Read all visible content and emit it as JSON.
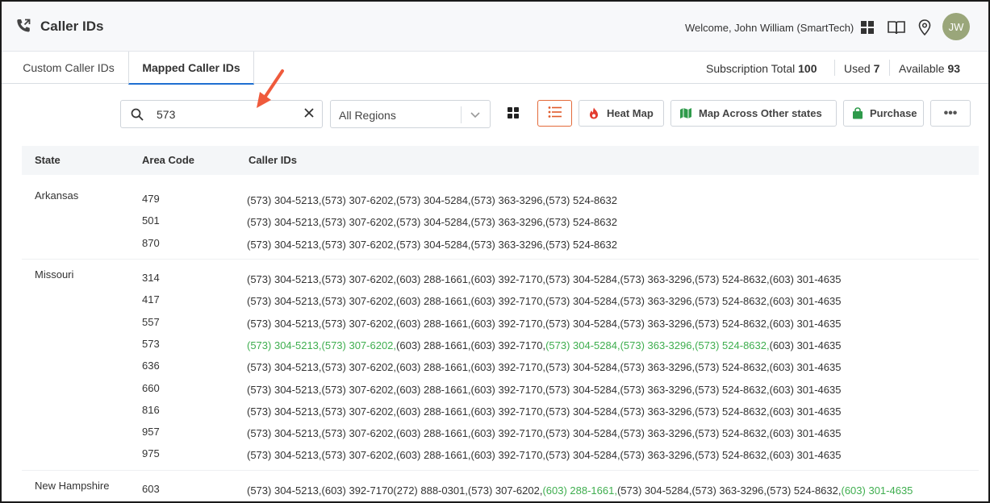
{
  "header": {
    "title": "Caller IDs",
    "app_icon": "phone-forward-icon",
    "welcome_prefix": "Welcome, John William ",
    "welcome_org": "(SmartTech)",
    "icons": [
      "apps-grid-icon",
      "book-icon",
      "location-pin-icon"
    ],
    "avatar_initials": "JW",
    "avatar_color": "#9aa67a"
  },
  "tabs": [
    {
      "label": "Custom Caller IDs",
      "active": false
    },
    {
      "label": "Mapped Caller IDs",
      "active": true
    }
  ],
  "subscription": {
    "total_label": "Subscription Total",
    "total_value": "100",
    "used_label": "Used",
    "used_value": "7",
    "available_label": "Available",
    "available_value": "93"
  },
  "toolbar": {
    "search_value": "573",
    "region_value": "All Regions",
    "heat_map_label": "Heat Map",
    "map_across_label": "Map Across Other states",
    "purchase_label": "Purchase",
    "more_label": "•••",
    "accent_color": "#e05a2a",
    "heat_map_icon": "flame-icon",
    "map_across_icon": "map-icon",
    "purchase_icon": "shopping-bag-icon"
  },
  "table": {
    "headers": [
      "State",
      "Area Code",
      "Caller IDs"
    ],
    "highlight_color": "#3fae4f",
    "groups": [
      {
        "state": "Arkansas",
        "rows": [
          {
            "code": "479",
            "parts": [
              {
                "t": "(573) 304-5213,(573) 307-6202,(573) 304-5284,(573) 363-3296,(573) 524-8632",
                "h": false
              }
            ]
          },
          {
            "code": "501",
            "parts": [
              {
                "t": "(573) 304-5213,(573) 307-6202,(573) 304-5284,(573) 363-3296,(573) 524-8632",
                "h": false
              }
            ]
          },
          {
            "code": "870",
            "parts": [
              {
                "t": "(573) 304-5213,(573) 307-6202,(573) 304-5284,(573) 363-3296,(573) 524-8632",
                "h": false
              }
            ]
          }
        ]
      },
      {
        "state": "Missouri",
        "rows": [
          {
            "code": "314",
            "parts": [
              {
                "t": "(573) 304-5213,(573) 307-6202,(603) 288-1661,(603) 392-7170,(573) 304-5284,(573) 363-3296,(573) 524-8632,(603) 301-4635",
                "h": false
              }
            ]
          },
          {
            "code": "417",
            "parts": [
              {
                "t": "(573) 304-5213,(573) 307-6202,(603) 288-1661,(603) 392-7170,(573) 304-5284,(573) 363-3296,(573) 524-8632,(603) 301-4635",
                "h": false
              }
            ]
          },
          {
            "code": "557",
            "parts": [
              {
                "t": "(573) 304-5213,(573) 307-6202,(603) 288-1661,(603) 392-7170,(573) 304-5284,(573) 363-3296,(573) 524-8632,(603) 301-4635",
                "h": false
              }
            ]
          },
          {
            "code": "573",
            "parts": [
              {
                "t": "(573) 304-5213,(573) 307-6202,",
                "h": true
              },
              {
                "t": "(603) 288-1661,(603) 392-7170,",
                "h": false
              },
              {
                "t": "(573) 304-5284,(573) 363-3296,(573) 524-8632,",
                "h": true
              },
              {
                "t": "(603) 301-4635",
                "h": false
              }
            ]
          },
          {
            "code": "636",
            "parts": [
              {
                "t": "(573) 304-5213,(573) 307-6202,(603) 288-1661,(603) 392-7170,(573) 304-5284,(573) 363-3296,(573) 524-8632,(603) 301-4635",
                "h": false
              }
            ]
          },
          {
            "code": "660",
            "parts": [
              {
                "t": "(573) 304-5213,(573) 307-6202,(603) 288-1661,(603) 392-7170,(573) 304-5284,(573) 363-3296,(573) 524-8632,(603) 301-4635",
                "h": false
              }
            ]
          },
          {
            "code": "816",
            "parts": [
              {
                "t": "(573) 304-5213,(573) 307-6202,(603) 288-1661,(603) 392-7170,(573) 304-5284,(573) 363-3296,(573) 524-8632,(603) 301-4635",
                "h": false
              }
            ]
          },
          {
            "code": "957",
            "parts": [
              {
                "t": "(573) 304-5213,(573) 307-6202,(603) 288-1661,(603) 392-7170,(573) 304-5284,(573) 363-3296,(573) 524-8632,(603) 301-4635",
                "h": false
              }
            ]
          },
          {
            "code": "975",
            "parts": [
              {
                "t": "(573) 304-5213,(573) 307-6202,(603) 288-1661,(603) 392-7170,(573) 304-5284,(573) 363-3296,(573) 524-8632,(603) 301-4635",
                "h": false
              }
            ]
          }
        ]
      },
      {
        "state": "New Hampshire",
        "rows": [
          {
            "code": "603",
            "parts": [
              {
                "t": "(573) 304-5213,(603) 392-7170(272) 888-0301,(573) 307-6202,",
                "h": false
              },
              {
                "t": "(603) 288-1661,",
                "h": true
              },
              {
                "t": "(573) 304-5284,(573) 363-3296,(573) 524-8632,",
                "h": false
              },
              {
                "t": "(603) 301-4635",
                "h": true
              }
            ]
          }
        ]
      }
    ]
  }
}
